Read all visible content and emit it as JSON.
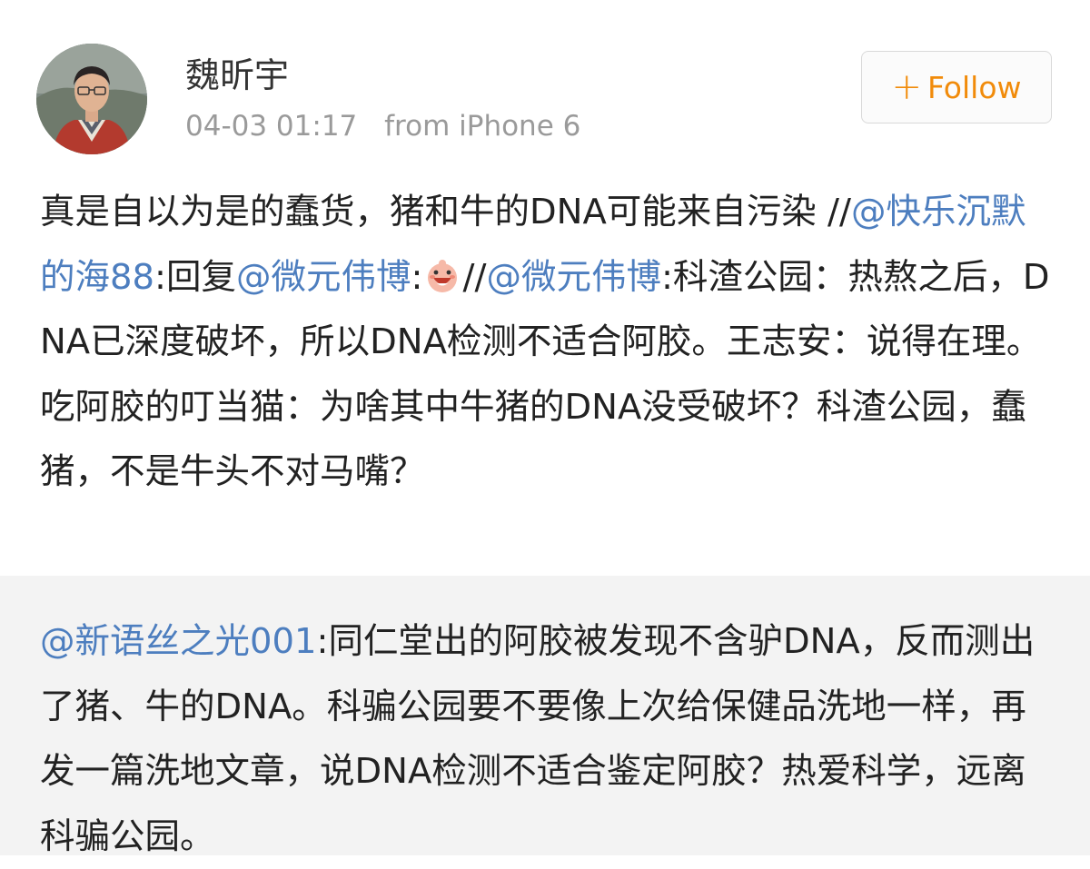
{
  "user": {
    "name": "魏昕宇",
    "time": "04-03 01:17",
    "source": "from iPhone 6"
  },
  "follow_button": {
    "icon": "plus-icon",
    "label": "Follow",
    "color": "#f18b0a"
  },
  "post": {
    "p1": "真是自以为是的蠢货，猪和牛的DNA可能来自污染 //",
    "m1": "@快乐沉默的海88",
    "p2": ":回复",
    "m2": "@微元伟博",
    "p3": ":",
    "emoji": "smiley-emoji",
    "p4": "//",
    "m3": "@微元伟博",
    "p5": ":科渣公园：热熬之后，DNA已深度破坏，所以DNA检测不适合阿胶。王志安：说得在理。吃阿胶的叮当猫：为啥其中牛猪的DNA没受破坏？科渣公园，蠢猪，不是牛头不对马嘴？"
  },
  "retweet": {
    "mention": "@新语丝之光001",
    "text": ":同仁堂出的阿胶被发现不含驴DNA，反而测出了猪、牛的DNA。科骗公园要不要像上次给保健品洗地一样，再发一篇洗地文章，说DNA检测不适合鉴定阿胶？热爱科学，远离科骗公园。"
  },
  "colors": {
    "link": "#4d7ebf",
    "meta": "#9a9a9a",
    "retweet_bg": "#f3f3f3"
  }
}
